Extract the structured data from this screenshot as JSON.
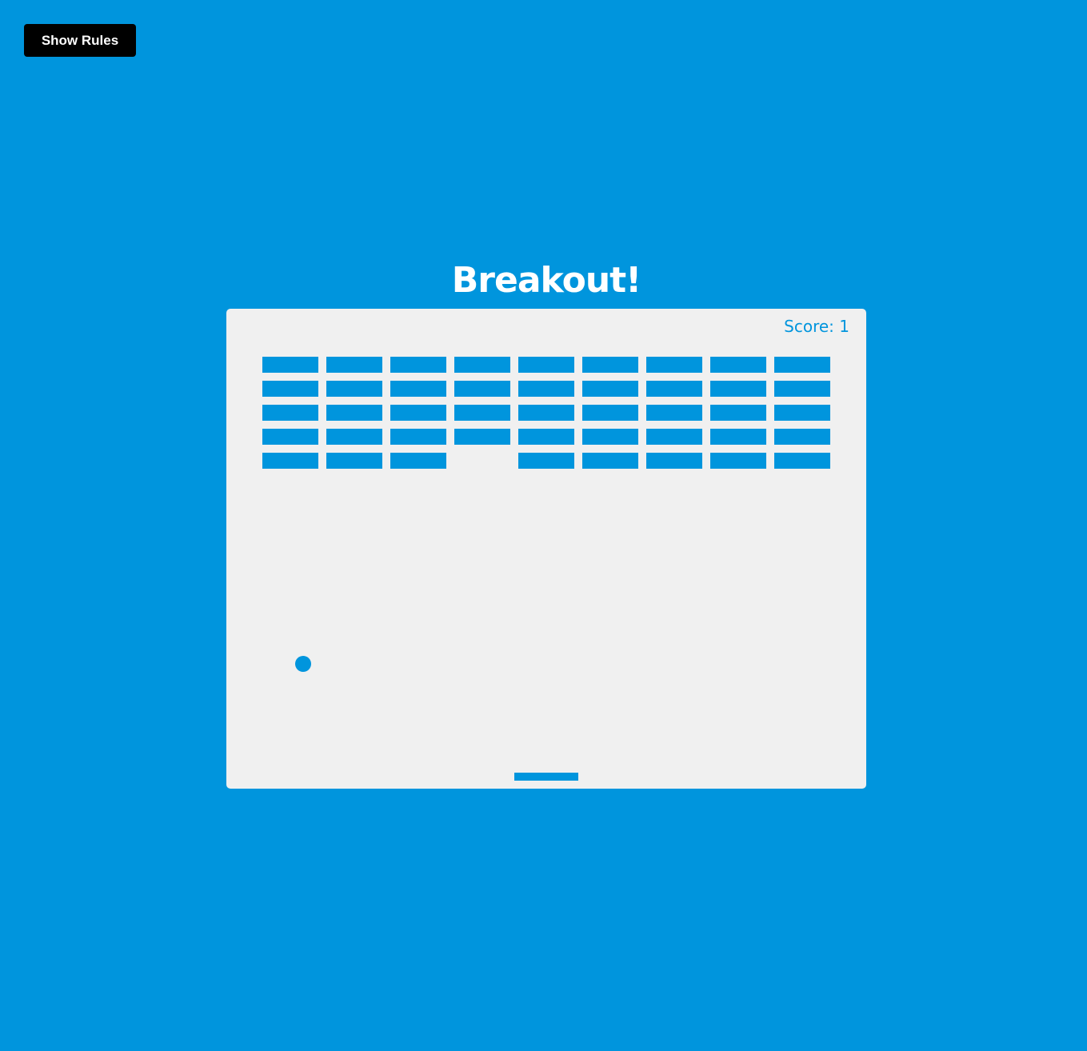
{
  "header": {
    "rules_button_label": "Show Rules",
    "title": "Breakout!"
  },
  "game": {
    "score_label": "Score: 1",
    "score": 1,
    "brick_color": "#0095dd",
    "board_color": "#f0f0f0",
    "background_color": "#0095dd",
    "brick_columns": 9,
    "brick_rows": 5,
    "bricks_visible": [
      [
        true,
        true,
        true,
        true,
        true
      ],
      [
        true,
        true,
        true,
        true,
        true
      ],
      [
        true,
        true,
        true,
        true,
        true
      ],
      [
        true,
        true,
        true,
        true,
        false
      ],
      [
        true,
        true,
        true,
        true,
        true
      ],
      [
        true,
        true,
        true,
        true,
        true
      ],
      [
        true,
        true,
        true,
        true,
        true
      ],
      [
        true,
        true,
        true,
        true,
        true
      ],
      [
        true,
        true,
        true,
        true,
        true
      ]
    ]
  }
}
